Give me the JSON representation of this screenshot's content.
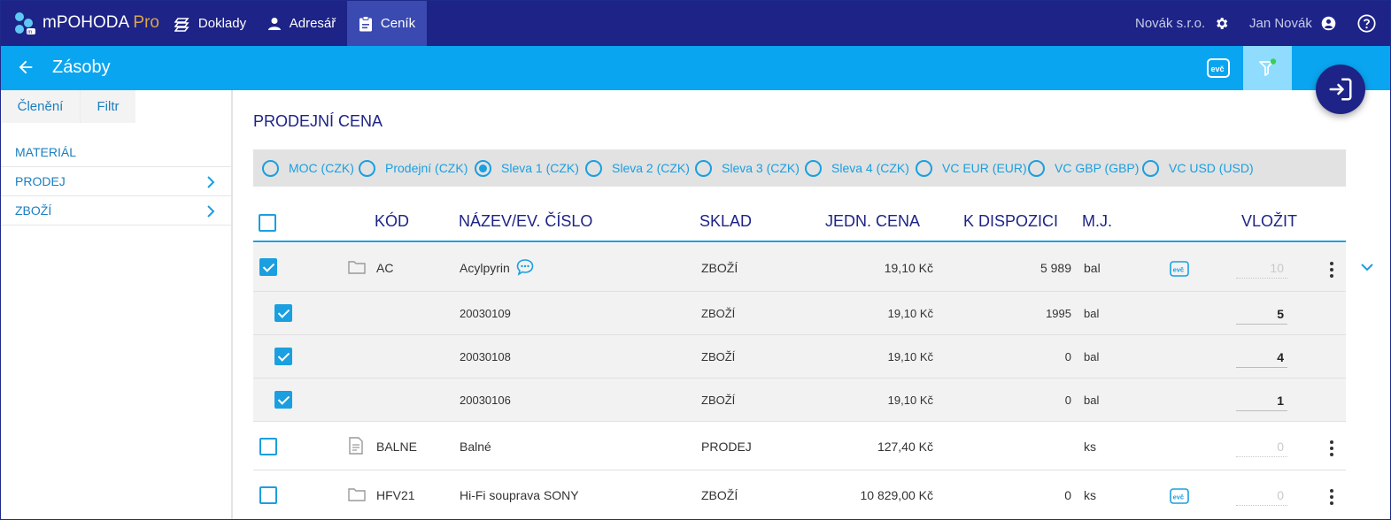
{
  "app": {
    "name": "mPOHODA",
    "edition": "Pro"
  },
  "nav": [
    {
      "label": "Doklady",
      "icon": "layers-icon"
    },
    {
      "label": "Adresář",
      "icon": "person-icon"
    },
    {
      "label": "Ceník",
      "icon": "clipboard-icon",
      "active": true
    }
  ],
  "topright": {
    "company": "Novák s.r.o.",
    "user": "Jan Novák"
  },
  "header": {
    "title": "Zásoby"
  },
  "sidebar": {
    "tabs": [
      {
        "label": "Členění"
      },
      {
        "label": "Filtr"
      }
    ],
    "items": [
      {
        "label": "MATERIÁL"
      },
      {
        "label": "PRODEJ"
      },
      {
        "label": "ZBOŽÍ"
      }
    ]
  },
  "section": {
    "title": "PRODEJNÍ CENA"
  },
  "price_options": [
    {
      "label": "MOC (CZK)",
      "selected": false
    },
    {
      "label": "Prodejní (CZK)",
      "selected": false
    },
    {
      "label": "Sleva 1 (CZK)",
      "selected": true
    },
    {
      "label": "Sleva 2 (CZK)",
      "selected": false
    },
    {
      "label": "Sleva 3 (CZK)",
      "selected": false
    },
    {
      "label": "Sleva 4 (CZK)",
      "selected": false
    },
    {
      "label": "VC EUR (EUR)",
      "selected": false
    },
    {
      "label": "VC GBP (GBP)",
      "selected": false
    },
    {
      "label": "VC USD (USD)",
      "selected": false
    }
  ],
  "table": {
    "headers": {
      "kod": "KÓD",
      "nazev": "NÁZEV/EV. ČÍSLO",
      "sklad": "SKLAD",
      "cena": "JEDN. CENA",
      "dispozice": "K DISPOZICI",
      "mj": "M.J.",
      "vlozit": "VLOŽIT"
    },
    "rows": [
      {
        "checked": true,
        "icon": "folder-icon",
        "kod": "AC",
        "nazev": "Acylpyrin",
        "sklad": "ZBOŽÍ",
        "cena": "19,10 Kč",
        "dispozice": "5 989",
        "mj": "bal",
        "evc": "evč",
        "vlozit": "10"
      },
      {
        "checked": true,
        "nazev": "20030109",
        "sklad": "ZBOŽÍ",
        "cena": "19,10 Kč",
        "dispozice": "1995",
        "mj": "bal",
        "vlozit": "5"
      },
      {
        "checked": true,
        "nazev": "20030108",
        "sklad": "ZBOŽÍ",
        "cena": "19,10 Kč",
        "dispozice": "0",
        "mj": "bal",
        "vlozit": "4"
      },
      {
        "checked": true,
        "nazev": "20030106",
        "sklad": "ZBOŽÍ",
        "cena": "19,10 Kč",
        "dispozice": "0",
        "mj": "bal",
        "vlozit": "1"
      },
      {
        "checked": false,
        "icon": "document-icon",
        "kod": "BALNE",
        "nazev": "Balné",
        "sklad": "PRODEJ",
        "cena": "127,40 Kč",
        "dispozice": "",
        "mj": "ks",
        "vlozit": "0"
      },
      {
        "checked": false,
        "icon": "folder-icon",
        "kod": "HFV21",
        "nazev": "Hi-Fi souprava SONY",
        "sklad": "ZBOŽÍ",
        "cena": "10 829,00 Kč",
        "dispozice": "0",
        "mj": "ks",
        "evc": "evč",
        "vlozit": "0"
      }
    ]
  },
  "header_evc_label": "evč",
  "colors": {
    "nav": "#1e2387",
    "header": "#0aa5f0",
    "accent": "#1a9fe0",
    "brand_pro": "#d9a748"
  }
}
